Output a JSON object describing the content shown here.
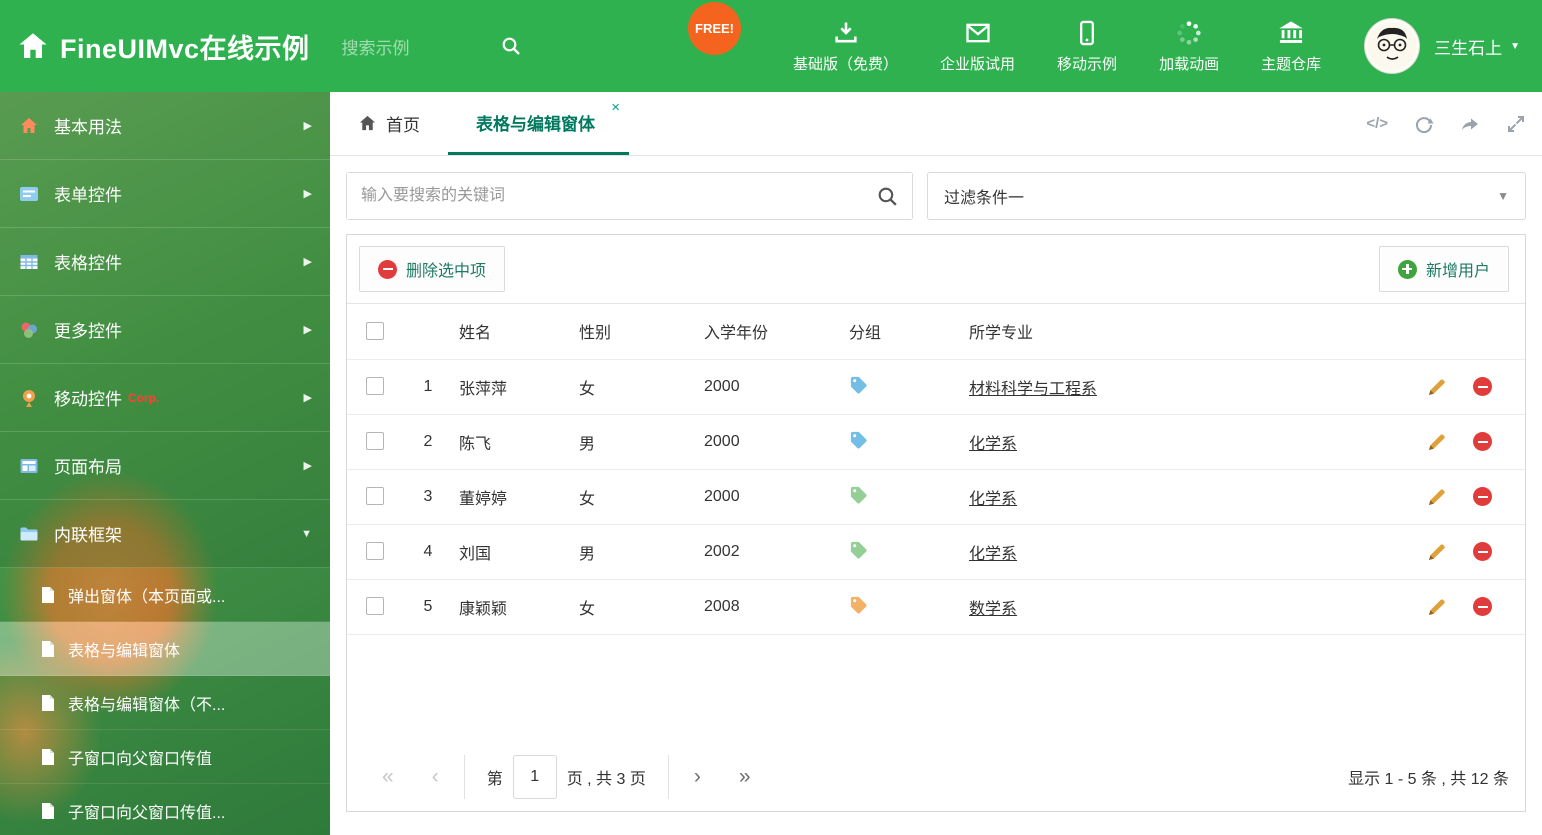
{
  "header": {
    "brand": "FineUIMvc在线示例",
    "search_placeholder": "搜索示例",
    "free_badge": "FREE!",
    "nav_items": [
      {
        "label": "基础版（免费）"
      },
      {
        "label": "企业版试用"
      },
      {
        "label": "移动示例"
      },
      {
        "label": "加载动画"
      },
      {
        "label": "主题仓库"
      }
    ],
    "username": "三生石上"
  },
  "sidebar": {
    "menu": [
      {
        "label": "基本用法"
      },
      {
        "label": "表单控件"
      },
      {
        "label": "表格控件"
      },
      {
        "label": "更多控件"
      },
      {
        "label": "移动控件",
        "badge": "Corp."
      },
      {
        "label": "页面布局"
      },
      {
        "label": "内联框架"
      }
    ],
    "submenu": [
      {
        "label": "弹出窗体（本页面或..."
      },
      {
        "label": "表格与编辑窗体"
      },
      {
        "label": "表格与编辑窗体（不..."
      },
      {
        "label": "子窗口向父窗口传值"
      },
      {
        "label": "子窗口向父窗口传值..."
      }
    ]
  },
  "tabs": {
    "home": "首页",
    "active": "表格与编辑窗体"
  },
  "filters": {
    "search_placeholder": "输入要搜索的关键词",
    "dropdown_value": "过滤条件一"
  },
  "grid": {
    "toolbar": {
      "delete_label": "删除选中项",
      "add_label": "新增用户"
    },
    "columns": [
      "姓名",
      "性别",
      "入学年份",
      "分组",
      "所学专业"
    ],
    "rows": [
      {
        "index": "1",
        "name": "张萍萍",
        "gender": "女",
        "year": "2000",
        "tag_color": "#74bde4",
        "major": "材料科学与工程系"
      },
      {
        "index": "2",
        "name": "陈飞",
        "gender": "男",
        "year": "2000",
        "tag_color": "#74bde4",
        "major": "化学系"
      },
      {
        "index": "3",
        "name": "董婷婷",
        "gender": "女",
        "year": "2000",
        "tag_color": "#95cf95",
        "major": "化学系"
      },
      {
        "index": "4",
        "name": "刘国",
        "gender": "男",
        "year": "2002",
        "tag_color": "#95cf95",
        "major": "化学系"
      },
      {
        "index": "5",
        "name": "康颖颖",
        "gender": "女",
        "year": "2008",
        "tag_color": "#f3b168",
        "major": "数学系"
      }
    ],
    "pager": {
      "prefix": "第",
      "page_value": "1",
      "suffix": "页 , 共 3 页",
      "summary": "显示 1 - 5 条 , 共 12 条"
    }
  },
  "icons": {
    "caret_down": "▼",
    "menu_arrow": "▶",
    "menu_arrow_open": "▼",
    "close": "×",
    "code": "</>",
    "pager_first": "«",
    "pager_prev": "‹",
    "pager_next": "›",
    "pager_last": "»"
  },
  "colors": {
    "header_green": "#2fb14f",
    "active_tab_teal": "#00795f",
    "delete_red": "#e03c3c",
    "add_green": "#3fa43f",
    "pencil_orange": "#dfa23a"
  }
}
